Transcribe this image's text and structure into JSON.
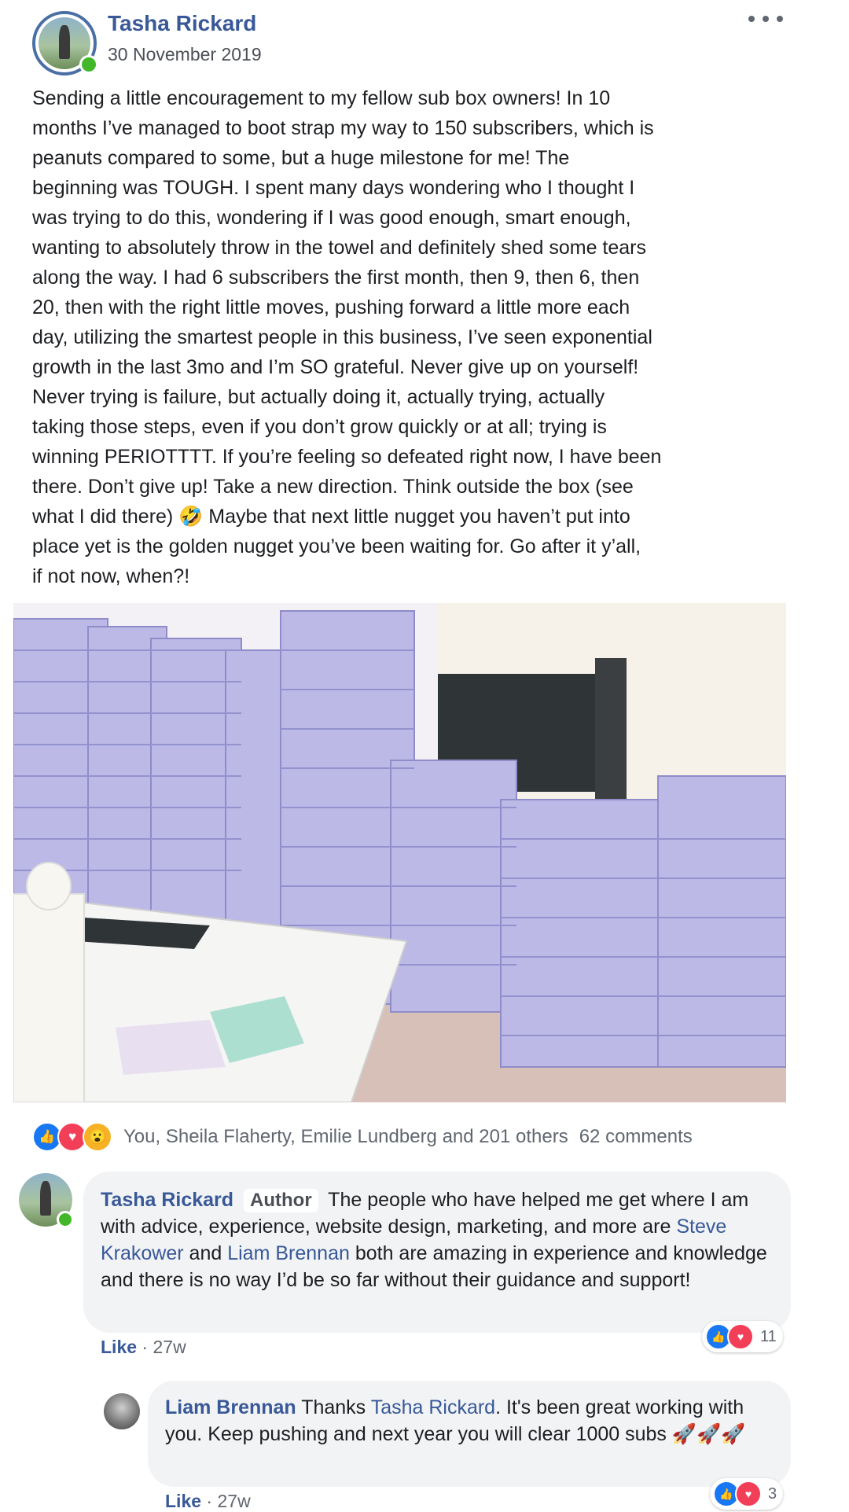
{
  "post": {
    "author": "Tasha Rickard",
    "date": "30 November 2019",
    "text": "Sending a little encouragement to my fellow sub box owners! In 10\nmonths I’ve managed to boot strap my way to 150 subscribers, which is\npeanuts compared to some, but a huge milestone for me! The\nbeginning was TOUGH. I spent many days wondering who I thought I\nwas trying to do this, wondering if I was good enough, smart enough,\nwanting to absolutely throw in the towel and definitely shed some tears\nalong the way. I had 6 subscribers the first month, then 9, then 6, then\n20, then with the right little moves, pushing forward a little more each\nday, utilizing the smartest people in this business, I’ve seen exponential\ngrowth in the last 3mo and I’m SO grateful. Never give up on yourself!\nNever trying is failure, but actually doing it, actually trying, actually\ntaking those steps, even if you don’t grow quickly or at all; trying is\nwinning PERIOTTTT. If you’re feeling so defeated right now, I have been\nthere. Don’t give up! Take a new direction. Think outside the box (see\nwhat I did there) 🤣 Maybe that next little nugget you haven’t put into\nplace yet is the golden nugget you’ve been waiting for. Go after it y’all,\nif not now, when?!"
  },
  "reactions": {
    "summary": "You, Sheila Flaherty, Emilie Lundberg and 201 others",
    "comments": "62 comments",
    "icons": [
      "like-icon",
      "love-icon",
      "wow-icon"
    ]
  },
  "comments": [
    {
      "author": "Tasha Rickard",
      "badge": "Author",
      "text_1": "The people who have helped me get where I am with advice, experience, website design, marketing, and more are",
      "mention_1": "Steve Krakower",
      "text_2": "and",
      "mention_2": "Liam Brennan",
      "text_3": "both are amazing in experience and knowledge and there is no way I’d be so far without their guidance and support!",
      "like_label": "Like",
      "time": "27w",
      "reaction_count": "11"
    },
    {
      "author": "Liam Brennan",
      "text_1": "Thanks",
      "mention_1": "Tasha Rickard",
      "text_2": ". It's been great working with you. Keep pushing and next year you will clear 1000 subs",
      "emoji": "🚀🚀🚀",
      "like_label": "Like",
      "time": "27w",
      "reaction_count": "3"
    }
  ],
  "colors": {
    "link": "#385898",
    "like": "#1877f2",
    "love": "#f33e58",
    "wow": "#f7b125",
    "bubble": "#f2f3f5"
  }
}
